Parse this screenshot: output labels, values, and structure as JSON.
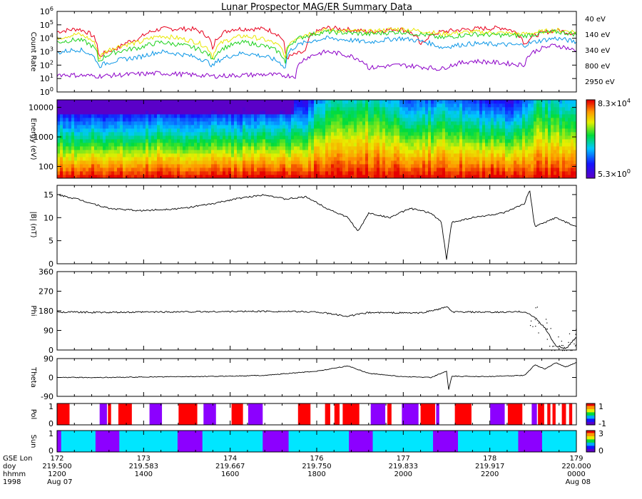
{
  "title": "Lunar Prospector MAG/ER Summary Data",
  "time_axis": {
    "rows": [
      {
        "label": "GSE Lon",
        "values": [
          "172",
          "173",
          "174",
          "176",
          "177",
          "178",
          "179"
        ]
      },
      {
        "label": "doy",
        "values": [
          "219.500",
          "219.583",
          "219.667",
          "219.750",
          "219.833",
          "219.917",
          "220.000"
        ]
      },
      {
        "label": "hhmm",
        "values": [
          "1200",
          "1400",
          "1600",
          "1800",
          "2000",
          "2200",
          "0000"
        ]
      },
      {
        "label": "1998",
        "values": [
          "Aug 07",
          "",
          "",
          "",
          "",
          "",
          "Aug 08"
        ]
      }
    ]
  },
  "colors": {
    "40eV": "#e8001c",
    "140eV": "#e8e800",
    "340eV": "#1ed21e",
    "800eV": "#0a96e6",
    "2950eV": "#8c00c8",
    "purple": "#8c00ff",
    "cyan": "#00e6ff",
    "red": "#ff0000"
  },
  "chart_data": [
    {
      "type": "line",
      "panel": "count-rate",
      "ylabel": "Count Rate",
      "yscale": "log",
      "ylim": [
        1,
        1000000
      ],
      "y_ticks": [
        "10^0",
        "10^1",
        "10^2",
        "10^3",
        "10^4",
        "10^5",
        "10^6"
      ],
      "x_range_doy": [
        219.5,
        220.0
      ],
      "series": [
        {
          "name": "40 eV",
          "color": "#e8001c",
          "points": [
            [
              219.5,
              30000
            ],
            [
              219.52,
              50000
            ],
            [
              219.54,
              300
            ],
            [
              219.56,
              2000
            ],
            [
              219.58,
              10000
            ],
            [
              219.6,
              50000
            ],
            [
              219.63,
              50000
            ],
            [
              219.65,
              500
            ],
            [
              219.67,
              50000
            ],
            [
              219.7,
              50000
            ],
            [
              219.72,
              300
            ],
            [
              219.74,
              1000
            ],
            [
              219.76,
              60000
            ],
            [
              219.8,
              30000
            ],
            [
              219.83,
              50000
            ],
            [
              219.85,
              2000
            ],
            [
              219.87,
              30000
            ],
            [
              219.9,
              50000
            ],
            [
              219.93,
              60000
            ],
            [
              219.95,
              3000
            ],
            [
              219.98,
              40000
            ],
            [
              220.0,
              20000
            ]
          ]
        },
        {
          "name": "140 eV",
          "color": "#e8e800",
          "points": [
            [
              219.5,
              10000
            ],
            [
              219.52,
              20000
            ],
            [
              219.54,
              200
            ],
            [
              219.58,
              5000
            ],
            [
              219.6,
              15000
            ],
            [
              219.65,
              300
            ],
            [
              219.68,
              15000
            ],
            [
              219.72,
              200
            ],
            [
              219.76,
              40000
            ],
            [
              219.8,
              30000
            ],
            [
              219.83,
              50000
            ],
            [
              219.87,
              20000
            ],
            [
              219.9,
              30000
            ],
            [
              219.95,
              20000
            ],
            [
              219.98,
              40000
            ],
            [
              220.0,
              30000
            ]
          ]
        },
        {
          "name": "340 eV",
          "color": "#1ed21e",
          "points": [
            [
              219.5,
              5000
            ],
            [
              219.52,
              8000
            ],
            [
              219.54,
              150
            ],
            [
              219.58,
              2000
            ],
            [
              219.6,
              5000
            ],
            [
              219.65,
              200
            ],
            [
              219.68,
              5000
            ],
            [
              219.72,
              100
            ],
            [
              219.76,
              30000
            ],
            [
              219.8,
              20000
            ],
            [
              219.83,
              30000
            ],
            [
              219.87,
              10000
            ],
            [
              219.9,
              20000
            ],
            [
              219.95,
              15000
            ],
            [
              219.98,
              30000
            ],
            [
              220.0,
              20000
            ]
          ]
        },
        {
          "name": "800 eV",
          "color": "#0a96e6",
          "points": [
            [
              219.5,
              800
            ],
            [
              219.52,
              1500
            ],
            [
              219.54,
              80
            ],
            [
              219.58,
              400
            ],
            [
              219.6,
              1000
            ],
            [
              219.65,
              80
            ],
            [
              219.68,
              800
            ],
            [
              219.72,
              50
            ],
            [
              219.76,
              10000
            ],
            [
              219.8,
              5000
            ],
            [
              219.83,
              10000
            ],
            [
              219.87,
              2000
            ],
            [
              219.9,
              4000
            ],
            [
              219.95,
              3000
            ],
            [
              219.98,
              10000
            ],
            [
              220.0,
              5000
            ]
          ]
        },
        {
          "name": "2950 eV",
          "color": "#8c00c8",
          "points": [
            [
              219.5,
              20
            ],
            [
              219.54,
              15
            ],
            [
              219.6,
              25
            ],
            [
              219.65,
              15
            ],
            [
              219.7,
              20
            ],
            [
              219.73,
              15
            ],
            [
              219.76,
              1000
            ],
            [
              219.8,
              60
            ],
            [
              219.83,
              100
            ],
            [
              219.87,
              50
            ],
            [
              219.9,
              200
            ],
            [
              219.95,
              100
            ],
            [
              219.98,
              3000
            ],
            [
              220.0,
              1000
            ]
          ]
        }
      ]
    },
    {
      "type": "heatmap",
      "panel": "energy-spectrogram",
      "ylabel": "Energy (eV)",
      "yscale": "log",
      "ylim": [
        40,
        18000
      ],
      "y_ticks": [
        "100",
        "1000",
        "10000"
      ],
      "colorbar": {
        "max_label": "8.3×10^4",
        "min_label": "5.3×10^0"
      }
    },
    {
      "type": "line",
      "panel": "b-magnitude",
      "ylabel": "|B| (nT)",
      "ylim": [
        0,
        17
      ],
      "y_ticks": [
        "0",
        "5",
        "10",
        "15"
      ],
      "points": [
        [
          219.5,
          15
        ],
        [
          219.52,
          14
        ],
        [
          219.55,
          12
        ],
        [
          219.58,
          11.5
        ],
        [
          219.62,
          12
        ],
        [
          219.65,
          13
        ],
        [
          219.67,
          14
        ],
        [
          219.7,
          15
        ],
        [
          219.72,
          14
        ],
        [
          219.74,
          14.5
        ],
        [
          219.76,
          12
        ],
        [
          219.78,
          10
        ],
        [
          219.79,
          7
        ],
        [
          219.8,
          11
        ],
        [
          219.82,
          10
        ],
        [
          219.84,
          12
        ],
        [
          219.86,
          11
        ],
        [
          219.87,
          9
        ],
        [
          219.875,
          1
        ],
        [
          219.88,
          9
        ],
        [
          219.9,
          10
        ],
        [
          219.93,
          11
        ],
        [
          219.95,
          13
        ],
        [
          219.955,
          16
        ],
        [
          219.96,
          8
        ],
        [
          219.97,
          9
        ],
        [
          219.98,
          10
        ],
        [
          220.0,
          8
        ]
      ]
    },
    {
      "type": "line",
      "panel": "phi",
      "ylabel": "Phi",
      "ylim": [
        0,
        360
      ],
      "y_ticks": [
        "0",
        "90",
        "180",
        "270",
        "360"
      ],
      "points": [
        [
          219.5,
          175
        ],
        [
          219.55,
          172
        ],
        [
          219.6,
          175
        ],
        [
          219.65,
          176
        ],
        [
          219.7,
          178
        ],
        [
          219.75,
          175
        ],
        [
          219.78,
          155
        ],
        [
          219.8,
          172
        ],
        [
          219.85,
          170
        ],
        [
          219.87,
          190
        ],
        [
          219.875,
          200
        ],
        [
          219.88,
          175
        ],
        [
          219.92,
          173
        ],
        [
          219.95,
          176
        ],
        [
          219.96,
          150
        ],
        [
          219.97,
          100
        ],
        [
          219.98,
          20
        ],
        [
          219.99,
          5
        ],
        [
          220.0,
          60
        ]
      ]
    },
    {
      "type": "line",
      "panel": "theta",
      "ylabel": "Theta",
      "ylim": [
        -90,
        90
      ],
      "y_ticks": [
        "-90",
        "0",
        "90"
      ],
      "points": [
        [
          219.5,
          0
        ],
        [
          219.55,
          0
        ],
        [
          219.6,
          3
        ],
        [
          219.65,
          5
        ],
        [
          219.7,
          10
        ],
        [
          219.75,
          30
        ],
        [
          219.78,
          55
        ],
        [
          219.8,
          20
        ],
        [
          219.83,
          5
        ],
        [
          219.86,
          0
        ],
        [
          219.875,
          30
        ],
        [
          219.877,
          -60
        ],
        [
          219.88,
          5
        ],
        [
          219.92,
          5
        ],
        [
          219.95,
          10
        ],
        [
          219.96,
          60
        ],
        [
          219.97,
          40
        ],
        [
          219.98,
          70
        ],
        [
          219.99,
          50
        ],
        [
          220.0,
          70
        ]
      ]
    },
    {
      "type": "heatmap",
      "panel": "pol",
      "ylabel": "Pol",
      "y_ticks": [
        "0",
        "1"
      ],
      "colorbar": {
        "ticks": [
          "1",
          "-1"
        ]
      },
      "segments": [
        {
          "from": 219.5,
          "to": 219.512,
          "color": "#ff0000"
        },
        {
          "from": 219.541,
          "to": 219.548,
          "color": "#8c00ff"
        },
        {
          "from": 219.549,
          "to": 219.552,
          "color": "#ff0000"
        },
        {
          "from": 219.559,
          "to": 219.572,
          "color": "#ff0000"
        },
        {
          "from": 219.589,
          "to": 219.601,
          "color": "#8c00ff"
        },
        {
          "from": 219.617,
          "to": 219.635,
          "color": "#ff0000"
        },
        {
          "from": 219.641,
          "to": 219.653,
          "color": "#8c00ff"
        },
        {
          "from": 219.668,
          "to": 219.679,
          "color": "#ff0000"
        },
        {
          "from": 219.684,
          "to": 219.698,
          "color": "#8c00ff"
        },
        {
          "from": 219.732,
          "to": 219.744,
          "color": "#ff0000"
        },
        {
          "from": 219.758,
          "to": 219.763,
          "color": "#ff0000"
        },
        {
          "from": 219.767,
          "to": 219.772,
          "color": "#ff0000"
        },
        {
          "from": 219.775,
          "to": 219.791,
          "color": "#ff0000"
        },
        {
          "from": 219.802,
          "to": 219.816,
          "color": "#8c00ff"
        },
        {
          "from": 219.818,
          "to": 219.822,
          "color": "#ff0000"
        },
        {
          "from": 219.832,
          "to": 219.848,
          "color": "#8c00ff"
        },
        {
          "from": 219.85,
          "to": 219.864,
          "color": "#ff0000"
        },
        {
          "from": 219.865,
          "to": 219.868,
          "color": "#8c00ff"
        },
        {
          "from": 219.883,
          "to": 219.899,
          "color": "#ff0000"
        },
        {
          "from": 219.917,
          "to": 219.931,
          "color": "#8c00ff"
        },
        {
          "from": 219.934,
          "to": 219.948,
          "color": "#ff0000"
        },
        {
          "from": 219.957,
          "to": 219.962,
          "color": "#8c00ff"
        },
        {
          "from": 219.963,
          "to": 219.969,
          "color": "#ff0000"
        },
        {
          "from": 219.972,
          "to": 219.975,
          "color": "#ff0000"
        },
        {
          "from": 219.977,
          "to": 219.98,
          "color": "#ff0000"
        },
        {
          "from": 219.986,
          "to": 219.99,
          "color": "#ff0000"
        },
        {
          "from": 219.993,
          "to": 219.996,
          "color": "#ff0000"
        }
      ]
    },
    {
      "type": "heatmap",
      "panel": "sun",
      "ylabel": "Sun",
      "y_ticks": [
        "0",
        "1"
      ],
      "colorbar": {
        "ticks": [
          "3",
          "0"
        ]
      },
      "segments": [
        {
          "from": 219.5,
          "to": 219.504,
          "color": "#8c00ff"
        },
        {
          "from": 219.504,
          "to": 219.537,
          "color": "#00e6ff"
        },
        {
          "from": 219.537,
          "to": 219.56,
          "color": "#8c00ff"
        },
        {
          "from": 219.56,
          "to": 219.616,
          "color": "#00e6ff"
        },
        {
          "from": 219.616,
          "to": 219.64,
          "color": "#8c00ff"
        },
        {
          "from": 219.64,
          "to": 219.698,
          "color": "#00e6ff"
        },
        {
          "from": 219.698,
          "to": 219.723,
          "color": "#8c00ff"
        },
        {
          "from": 219.723,
          "to": 219.781,
          "color": "#00e6ff"
        },
        {
          "from": 219.781,
          "to": 219.804,
          "color": "#8c00ff"
        },
        {
          "from": 219.804,
          "to": 219.862,
          "color": "#00e6ff"
        },
        {
          "from": 219.862,
          "to": 219.886,
          "color": "#8c00ff"
        },
        {
          "from": 219.886,
          "to": 219.944,
          "color": "#00e6ff"
        },
        {
          "from": 219.944,
          "to": 219.967,
          "color": "#8c00ff"
        },
        {
          "from": 219.967,
          "to": 220.0,
          "color": "#00e6ff"
        }
      ]
    }
  ]
}
